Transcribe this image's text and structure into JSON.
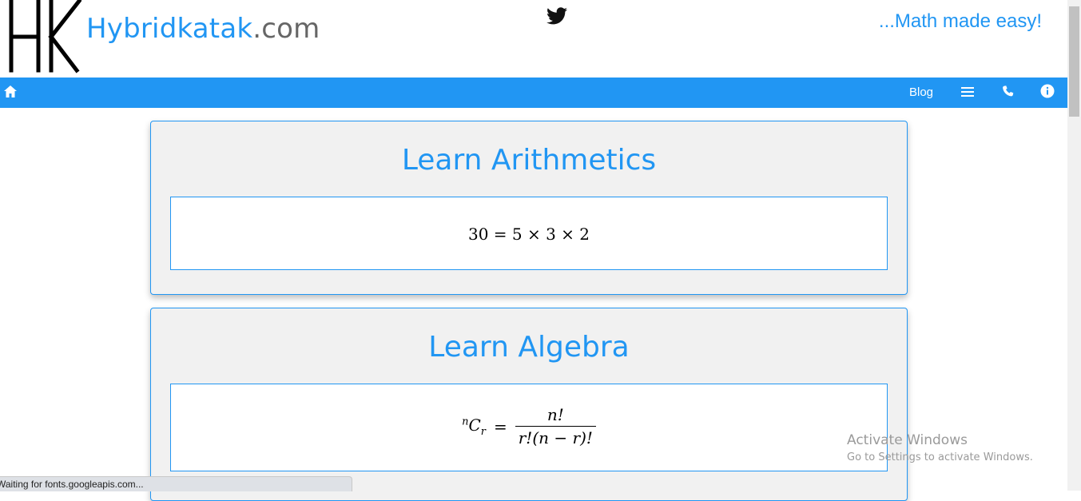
{
  "header": {
    "site_name": "Hybridkatak",
    "site_tld": ".com",
    "tagline": "...Math made easy!",
    "twitter_icon": "twitter-icon"
  },
  "navbar": {
    "home_icon": "home-icon",
    "blog_label": "Blog",
    "menu_icon": "menu-icon",
    "phone_icon": "phone-icon",
    "info_icon": "info-icon",
    "color": "#2196F3"
  },
  "cards": [
    {
      "title": "Learn Arithmetics",
      "formula": "30 = 5 × 3 × 2"
    },
    {
      "title": "Learn Algebra",
      "formula_lhs_sup": "n",
      "formula_lhs_base": "C",
      "formula_lhs_sub": "r",
      "formula_eq": "=",
      "formula_num": "n!",
      "formula_den": "r!(n − r)!"
    }
  ],
  "watermark": {
    "title": "Activate Windows",
    "subtitle": "Go to Settings to activate Windows."
  },
  "status": {
    "text": "Waiting for fonts.googleapis.com..."
  }
}
